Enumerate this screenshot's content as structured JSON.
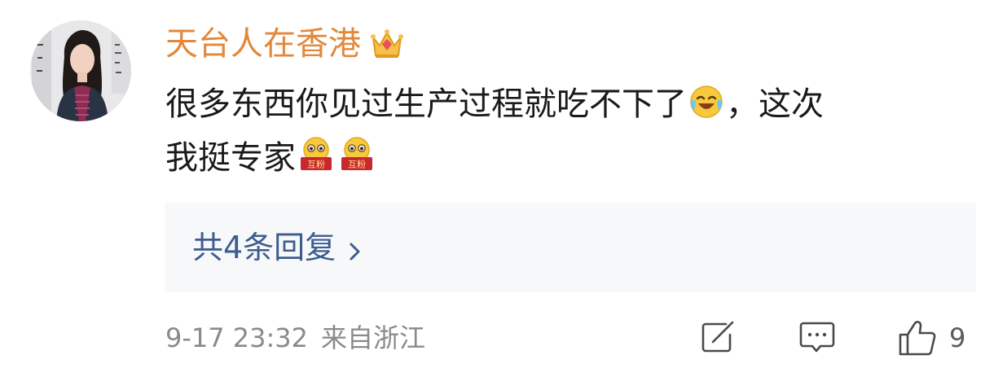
{
  "user": {
    "name": "天台人在香港",
    "badge_icon": "crown-icon"
  },
  "comment": {
    "line1": "很多东西你见过生产过程就吃不下了",
    "line1_suffix": "，这次",
    "line2": "我挺专家",
    "emoji_1": "laughing-crying-emoji",
    "emoji_2": "互粉",
    "emoji_3": "互粉"
  },
  "replies": {
    "label": "共4条回复"
  },
  "footer": {
    "timestamp": "9-17 23:32",
    "location": "来自浙江",
    "like_count": "9"
  },
  "colors": {
    "username": "#e2883a",
    "reply_link": "#3d5d8e",
    "reply_bg": "#f7f8fa",
    "meta": "#8a8a8a"
  }
}
